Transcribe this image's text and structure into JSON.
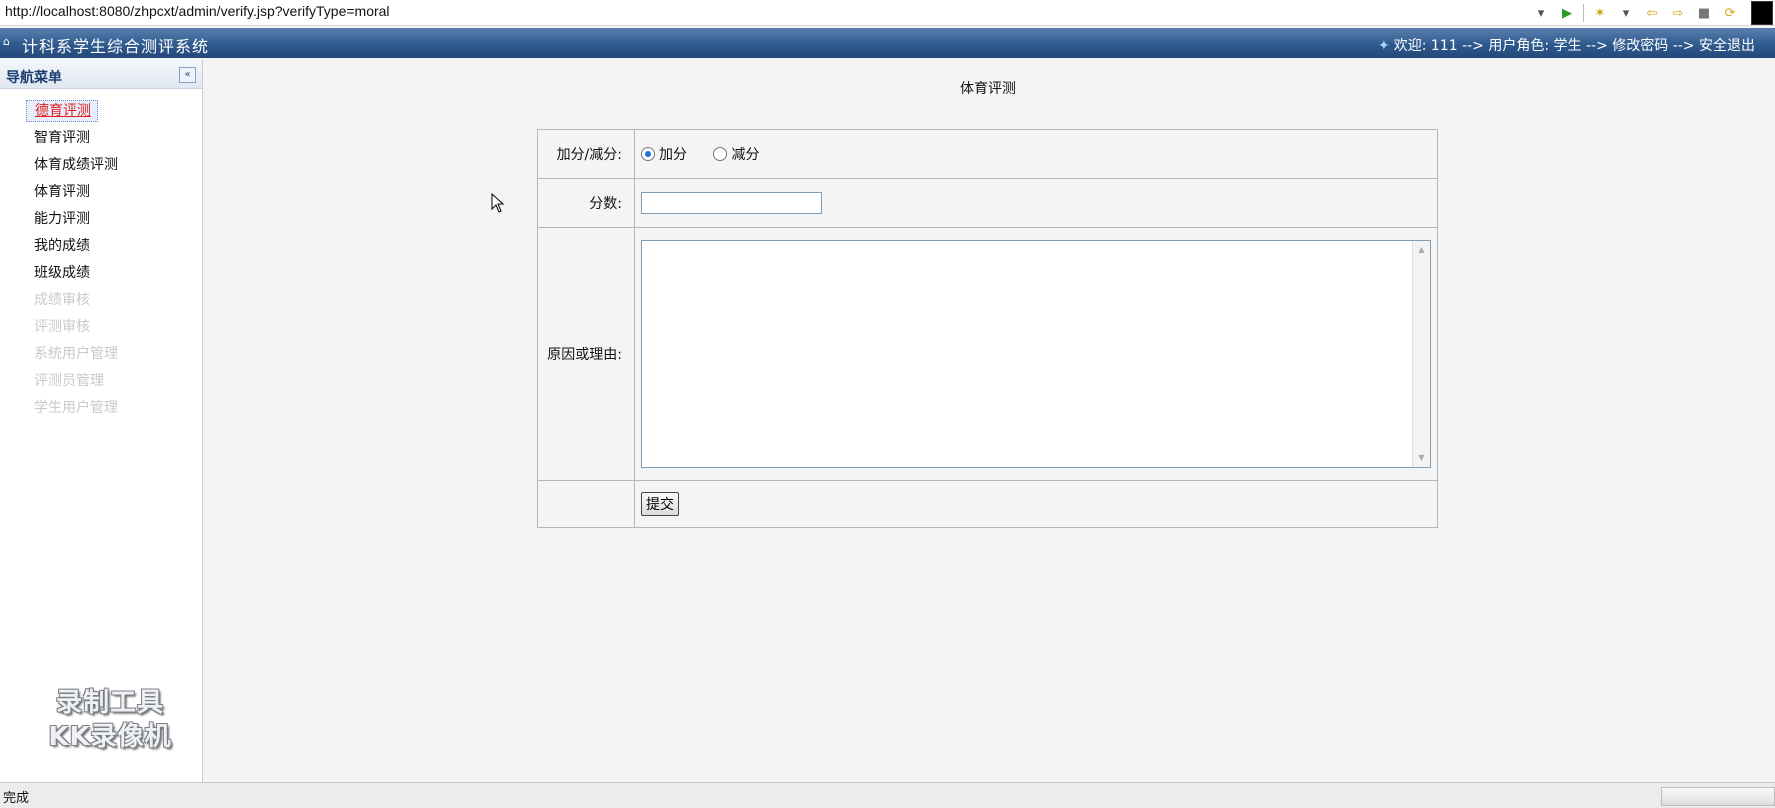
{
  "browser": {
    "url": "http://localhost:8080/zhpcxt/admin/verify.jsp?verifyType=moral"
  },
  "header": {
    "app_title": "计科系学生综合测评系统",
    "user_bar": "欢迎: 111 --> 用户角色: 学生 --> 修改密码 --> 安全退出"
  },
  "sidebar": {
    "title": "导航菜单",
    "collapse_icon": "«",
    "items": [
      {
        "label": "德育评测",
        "state": "active"
      },
      {
        "label": "智育评测",
        "state": "enabled"
      },
      {
        "label": "体育成绩评测",
        "state": "enabled"
      },
      {
        "label": "体育评测",
        "state": "enabled"
      },
      {
        "label": "能力评测",
        "state": "enabled"
      },
      {
        "label": "我的成绩",
        "state": "enabled"
      },
      {
        "label": "班级成绩",
        "state": "enabled"
      },
      {
        "label": "成绩审核",
        "state": "disabled"
      },
      {
        "label": "评测审核",
        "state": "disabled"
      },
      {
        "label": "系统用户管理",
        "state": "disabled"
      },
      {
        "label": "评测员管理",
        "state": "disabled"
      },
      {
        "label": "学生用户管理",
        "state": "disabled"
      }
    ]
  },
  "watermark": {
    "line1": "录制工具",
    "line2": "KK录像机"
  },
  "main": {
    "page_title": "体育评测",
    "form": {
      "type_label": "加分/减分:",
      "add_option": "加分",
      "subtract_option": "减分",
      "selected": "加分",
      "score_label": "分数:",
      "score_value": "",
      "reason_label": "原因或理由:",
      "reason_value": "",
      "submit_label": "提交"
    }
  },
  "statusbar": {
    "text": "完成"
  },
  "colors": {
    "header_blue": "#2f5a8e",
    "active_menu": "#e02020",
    "disabled_menu": "#c9c9c9"
  }
}
